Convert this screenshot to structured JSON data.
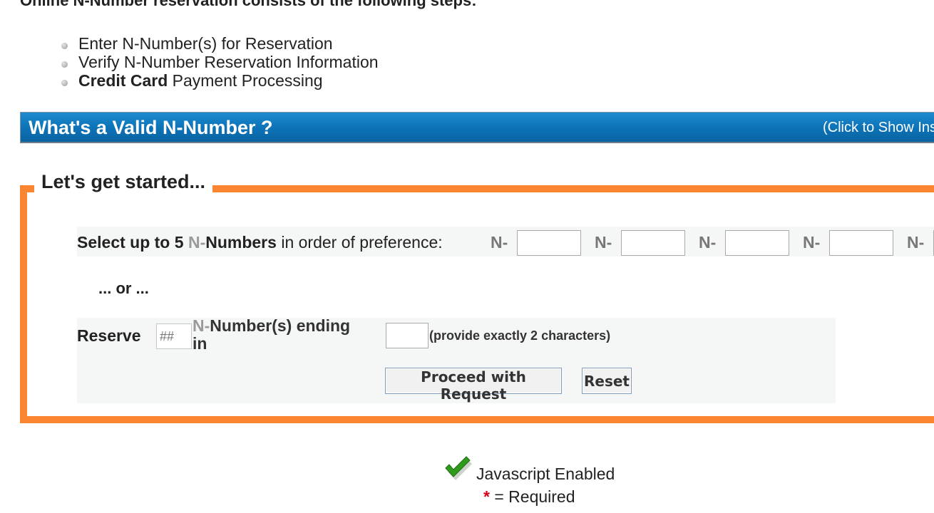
{
  "intro": {
    "heading": "Online N-Number reservation consists of the following steps:",
    "steps": [
      {
        "bold": "",
        "text": "Enter N-Number(s) for Reservation"
      },
      {
        "bold": "",
        "text": "Verify N-Number Reservation Information"
      },
      {
        "bold": "Credit Card",
        "text": " Payment Processing"
      }
    ]
  },
  "valid_bar": {
    "title": "What's a Valid N-Number ?",
    "link": "(Click to Show Ins"
  },
  "form": {
    "legend": "Let's get started...",
    "select_label": {
      "prefix": "Select up to 5 ",
      "n": "N",
      "dash": "-",
      "numbers": "Numbers",
      "suffix": " in order of preference:"
    },
    "n_prefix": "N-",
    "or_text": "... or ...",
    "reserve_label": "Reserve",
    "hash_placeholder": "##",
    "ending_n": "N",
    "ending_dash": "-",
    "ending_text": "Number(s) ending",
    "ending_in": "in",
    "exact_text": "(provide exactly 2 characters)",
    "proceed_label": "Proceed with Request",
    "reset_label": "Reset"
  },
  "footer": {
    "js_status": "Javascript Enabled",
    "required_star": "*",
    "required_text": " = Required"
  },
  "colors": {
    "accent_orange": "#fb8531",
    "bar_blue": "#0c72b6",
    "check_green": "#2f9a1c",
    "required_red": "#d0021b"
  }
}
